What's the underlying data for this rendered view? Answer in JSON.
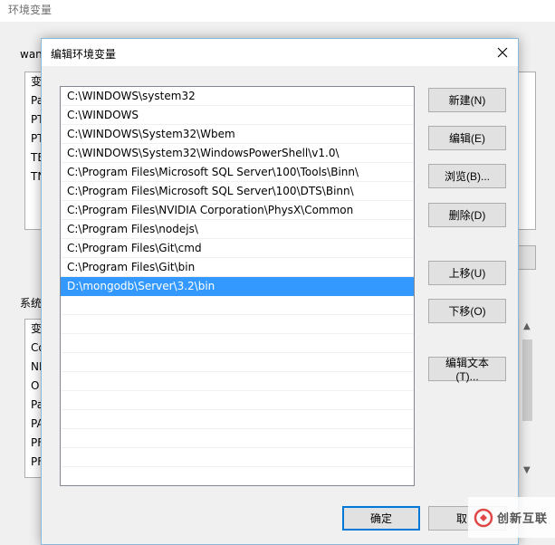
{
  "background_window": {
    "title": "环境变量",
    "user_section_label": "wan",
    "user_rows": [
      "变",
      "Pa",
      "PT",
      "PT",
      "TE",
      "TN"
    ],
    "system_section_label": "系统",
    "system_rows": [
      "变",
      "Co",
      "NI",
      "O",
      "Pa",
      "PA",
      "PF",
      "PF"
    ]
  },
  "dialog": {
    "title": "编辑环境变量",
    "paths": [
      "C:\\WINDOWS\\system32",
      "C:\\WINDOWS",
      "C:\\WINDOWS\\System32\\Wbem",
      "C:\\WINDOWS\\System32\\WindowsPowerShell\\v1.0\\",
      "C:\\Program Files\\Microsoft SQL Server\\100\\Tools\\Binn\\",
      "C:\\Program Files\\Microsoft SQL Server\\100\\DTS\\Binn\\",
      "C:\\Program Files\\NVIDIA Corporation\\PhysX\\Common",
      "C:\\Program Files\\nodejs\\",
      "C:\\Program Files\\Git\\cmd",
      "C:\\Program Files\\Git\\bin",
      "D:\\mongodb\\Server\\3.2\\bin",
      "",
      "",
      "",
      "",
      "",
      "",
      "",
      "",
      "",
      ""
    ],
    "selected_index": 10,
    "buttons": {
      "new": "新建(N)",
      "edit": "编辑(E)",
      "browse": "浏览(B)...",
      "delete": "删除(D)",
      "move_up": "上移(U)",
      "move_down": "下移(O)",
      "edit_text": "编辑文本(T)...",
      "ok": "确定",
      "cancel": "取"
    }
  },
  "watermark": {
    "name": "创新互联"
  },
  "colors": {
    "selection": "#3399ff",
    "dialog_border": "#8bbbdc",
    "primary_button_border": "#0078d7",
    "watermark": "#e04848"
  }
}
